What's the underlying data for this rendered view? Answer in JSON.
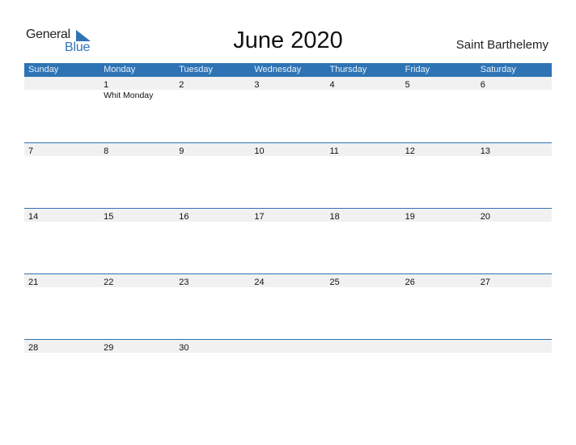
{
  "logo": {
    "text_general": "General",
    "text_blue": "Blue",
    "icon": "triangle-flag-icon"
  },
  "title": "June 2020",
  "country": "Saint Barthelemy",
  "colors": {
    "accent": "#2e74b5",
    "row_strip": "#f1f1f1"
  },
  "weekdays": [
    "Sunday",
    "Monday",
    "Tuesday",
    "Wednesday",
    "Thursday",
    "Friday",
    "Saturday"
  ],
  "weeks": [
    [
      "",
      "1",
      "2",
      "3",
      "4",
      "5",
      "6"
    ],
    [
      "7",
      "8",
      "9",
      "10",
      "11",
      "12",
      "13"
    ],
    [
      "14",
      "15",
      "16",
      "17",
      "18",
      "19",
      "20"
    ],
    [
      "21",
      "22",
      "23",
      "24",
      "25",
      "26",
      "27"
    ],
    [
      "28",
      "29",
      "30",
      "",
      "",
      "",
      ""
    ]
  ],
  "holidays": [
    {
      "week": 0,
      "day": 1,
      "label": "Whit Monday"
    }
  ]
}
